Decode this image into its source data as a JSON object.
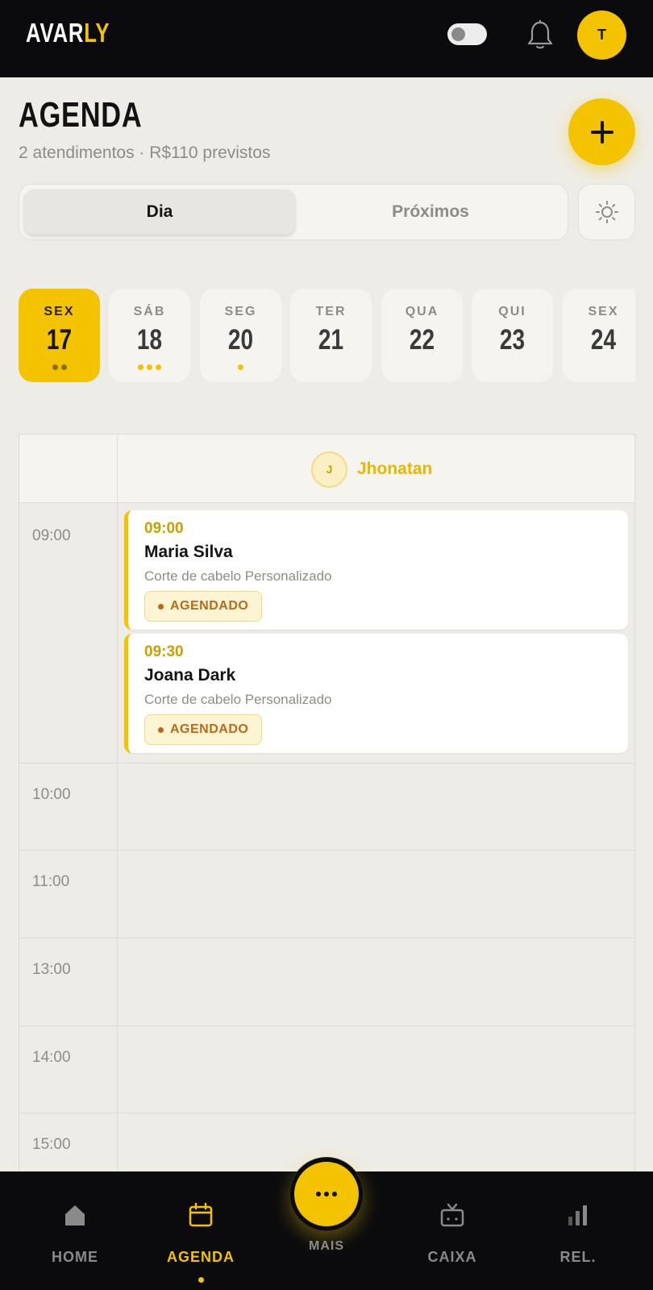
{
  "app": {
    "logo_main": "AVAR",
    "logo_accent": "LY",
    "user_initial": "T"
  },
  "header": {
    "title": "AGENDA",
    "subtitle": "2 atendimentos · R$110 previstos",
    "add_icon": "plus-icon"
  },
  "segment": {
    "tabs": [
      {
        "label": "Dia",
        "active": true
      },
      {
        "label": "Próximos",
        "active": false
      }
    ],
    "settings_icon": "sun-gear-icon"
  },
  "days": [
    {
      "dow": "SEX",
      "num": "17",
      "dots": 2,
      "active": true
    },
    {
      "dow": "SÁB",
      "num": "18",
      "dots": 3,
      "active": false
    },
    {
      "dow": "SEG",
      "num": "20",
      "dots": 1,
      "active": false
    },
    {
      "dow": "TER",
      "num": "21",
      "dots": 0,
      "active": false
    },
    {
      "dow": "QUA",
      "num": "22",
      "dots": 0,
      "active": false
    },
    {
      "dow": "QUI",
      "num": "23",
      "dots": 0,
      "active": false
    },
    {
      "dow": "SEX",
      "num": "24",
      "dots": 0,
      "active": false
    }
  ],
  "calendar": {
    "professional": {
      "initial": "J",
      "name": "Jhonatan"
    },
    "time_slots": [
      "09:00",
      "10:00",
      "11:00",
      "13:00",
      "14:00",
      "15:00"
    ],
    "appointments": [
      {
        "time": "09:00",
        "client": "Maria Silva",
        "service": "Corte de cabelo Personalizado",
        "status": "AGENDADO"
      },
      {
        "time": "09:30",
        "client": "Joana Dark",
        "service": "Corte de cabelo Personalizado",
        "status": "AGENDADO"
      }
    ]
  },
  "nav": {
    "items": [
      {
        "label": "HOME",
        "icon": "home-icon",
        "active": false
      },
      {
        "label": "AGENDA",
        "icon": "calendar-icon",
        "active": true
      },
      {
        "label": "MAIS",
        "icon": "more-dots-icon",
        "active": false
      },
      {
        "label": "CAIXA",
        "icon": "register-icon",
        "active": false
      },
      {
        "label": "REL.",
        "icon": "bar-chart-icon",
        "active": false
      }
    ]
  },
  "colors": {
    "accent": "#f3c300",
    "dark": "#0b0b0e",
    "background": "#eeece6",
    "status_scheduled": "#b86a1b"
  }
}
